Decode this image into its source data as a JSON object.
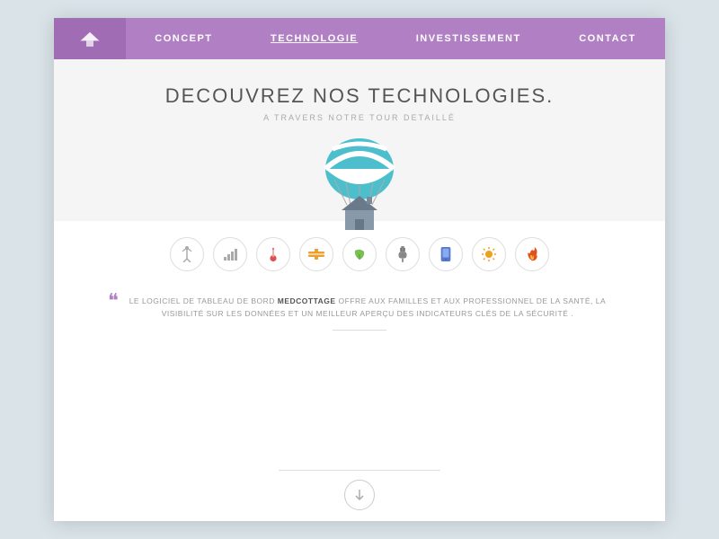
{
  "nav": {
    "logo_alt": "MedCottage Logo",
    "links": [
      {
        "id": "concept",
        "label": "CONCEPT",
        "active": false
      },
      {
        "id": "technologie",
        "label": "TECHNOLOGIE",
        "active": true
      },
      {
        "id": "investissement",
        "label": "INVESTISSEMENT",
        "active": false
      },
      {
        "id": "contact",
        "label": "CONTACT",
        "active": false
      }
    ]
  },
  "hero": {
    "title": "DECOUVREZ NOS TECHNOLOGIES.",
    "subtitle": "A TRAVERS NOTRE TOUR DETAILLÉ"
  },
  "icons": [
    {
      "id": "icon-antenna",
      "symbol": "📡",
      "unicode": "⊕"
    },
    {
      "id": "icon-signal",
      "symbol": "📶",
      "unicode": "≈"
    },
    {
      "id": "icon-temp",
      "symbol": "🌡",
      "unicode": "⊕"
    },
    {
      "id": "icon-tools",
      "symbol": "🔧",
      "unicode": "⊕"
    },
    {
      "id": "icon-leaf",
      "symbol": "🌿",
      "unicode": "⊕"
    },
    {
      "id": "icon-plug",
      "symbol": "🔌",
      "unicode": "⊕"
    },
    {
      "id": "icon-tablet",
      "symbol": "📱",
      "unicode": "⊕"
    },
    {
      "id": "icon-sun",
      "symbol": "☀",
      "unicode": "⊕"
    },
    {
      "id": "icon-fire",
      "symbol": "🔥",
      "unicode": "⊕"
    }
  ],
  "quote": {
    "mark": "❝",
    "text_before": "LE LOGICIEL DE TABLEAU DE BORD ",
    "brand": "MEDCOTTAGE",
    "text_after": " OFFRE AUX FAMILLES ET AUX PROFESSIONNEL DE LA SANTÉ, LA VISIBILITÉ SUR LES DONNÉES ET UN MEILLEUR APERÇU DES INDICATEURS CLÉS DE LA SÉCURITÉ ."
  },
  "colors": {
    "nav_bg": "#b07fc4",
    "nav_active_bg": "#a06db5",
    "parachute_top": "#4dbfcc",
    "parachute_stripe": "#fff",
    "house_body": "#8899aa",
    "accent_purple": "#b07fc4"
  }
}
